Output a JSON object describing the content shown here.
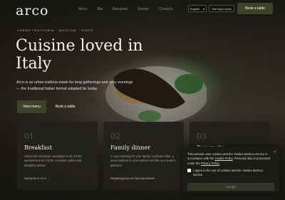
{
  "header": {
    "logo": "arco",
    "nav": [
      "Menu",
      "Bar",
      "Banquets",
      "Events",
      "Contacts"
    ],
    "lang": "English",
    "legal_label": "Site legal notes",
    "book_label": "Book a table"
  },
  "hero": {
    "tagline": "URBAN TRATTORIA · MOSCOW · SINCE",
    "title": "Cuisine loved in Italy",
    "desc": "Arco is an urban trattoria made for long gatherings and cosy evenings — the traditional Italian format adapted for today",
    "menu_label": "View menu",
    "book_label": "Book a table"
  },
  "cards": [
    {
      "num": "01",
      "title": "Breakfast",
      "text": "Unhurried mornings: weekdays 9:00–12:00, weekends 9:00–16:00. Aromatic coffee and delightful dishes",
      "link": "Завтраки в Arco →"
    },
    {
      "num": "02",
      "title": "Family dinner",
      "text": "A cozy evening for your family: a private table, a menu tailored to your wishes and the Arco team's attention",
      "link": "Индивидуальное бронирование →"
    },
    {
      "num": "03",
      "title": "Banquets",
      "text": "",
      "link": ""
    }
  ],
  "cookie": {
    "text_before": "This website uses cookies and the Yandex Metrica service in accordance with the ",
    "link1": "Cookie Policy",
    "text_mid": ". Personal data is processed under the ",
    "link2": "Privacy Policy",
    "text_end": ".",
    "close": "×",
    "agree": "I agree to the use of cookies and the Yandex Metrica service",
    "accept": "Accept"
  }
}
